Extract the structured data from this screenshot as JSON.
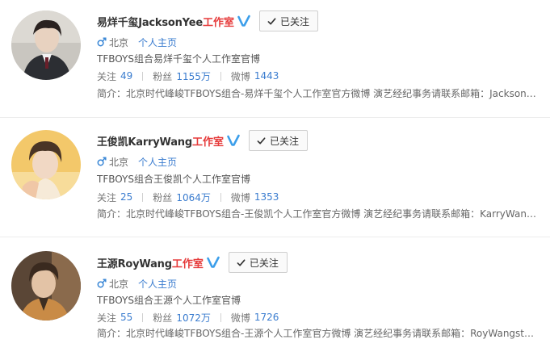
{
  "results": [
    {
      "name": "易烊千玺JacksonYee",
      "studio_suffix": "工作室",
      "follow_label": "已关注",
      "city": "北京",
      "homepage_link": "个人主页",
      "description": "TFBOYS组合易烊千玺个人工作室官博",
      "stats": {
        "following_label": "关注",
        "following_value": "49",
        "fans_label": "粉丝",
        "fans_value": "1155万",
        "weibo_label": "微博",
        "weibo_value": "1443"
      },
      "intro": "简介：北京时代峰峻TFBOYS组合-易烊千玺个人工作室官方微博 演艺经纪事务请联系邮箱：Jackson…"
    },
    {
      "name": "王俊凯KarryWang",
      "studio_suffix": "工作室",
      "follow_label": "已关注",
      "city": "北京",
      "homepage_link": "个人主页",
      "description": "TFBOYS组合王俊凯个人工作室官博",
      "stats": {
        "following_label": "关注",
        "following_value": "25",
        "fans_label": "粉丝",
        "fans_value": "1064万",
        "weibo_label": "微博",
        "weibo_value": "1353"
      },
      "intro": "简介：北京时代峰峻TFBOYS组合-王俊凯个人工作室官方微博 演艺经纪事务请联系邮箱：KarryWang…"
    },
    {
      "name": "王源RoyWang",
      "studio_suffix": "工作室",
      "follow_label": "已关注",
      "city": "北京",
      "homepage_link": "个人主页",
      "description": "TFBOYS组合王源个人工作室官博",
      "stats": {
        "following_label": "关注",
        "following_value": "55",
        "fans_label": "粉丝",
        "fans_value": "1072万",
        "weibo_label": "微博",
        "weibo_value": "1726"
      },
      "intro": "简介：北京时代峰峻TFBOYS组合-王源个人工作室官方微博 演艺经纪事务请联系邮箱：RoyWangstu…"
    }
  ],
  "icons": {
    "verified": "verified-v-icon",
    "follow_check": "check-icon",
    "gender": "male-icon"
  },
  "colors": {
    "studio_red": "#e63a3a",
    "link_blue": "#3a7ccf",
    "verified_blue": "#3b9eea",
    "male_blue": "#3a87d6"
  }
}
